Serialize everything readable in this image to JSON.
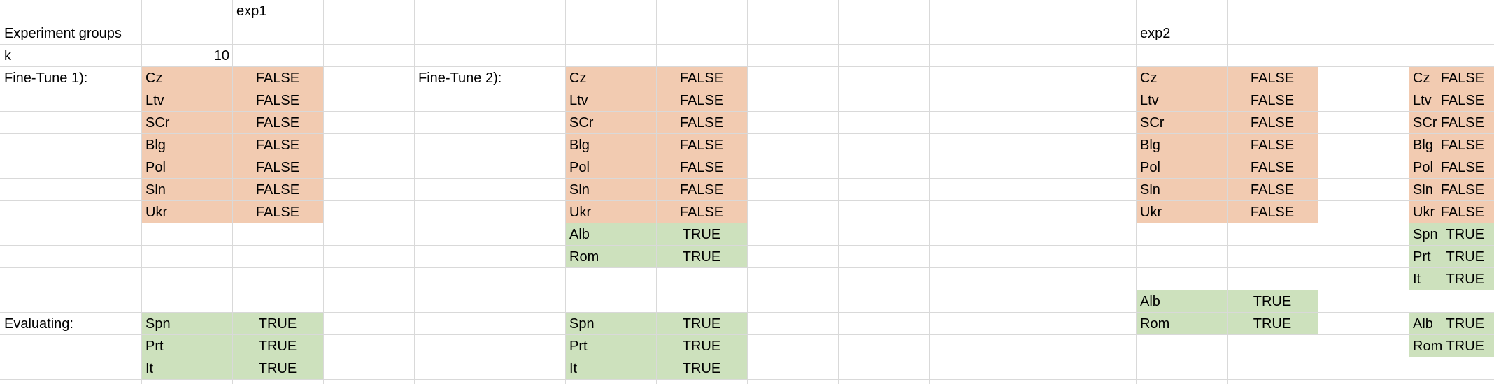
{
  "sheet": {
    "title": "exp1",
    "experiment_groups_label": "Experiment groups",
    "k_label": "k",
    "k_value": "10",
    "exp2_label": "exp2",
    "finetune1_label": "Fine-Tune 1):",
    "finetune2_label": "Fine-Tune 2):",
    "evaluating_label": "Evaluating:",
    "colors": {
      "salmon": "#f2cbb1",
      "green": "#cde1bd",
      "gridline": "#d9d9d9"
    },
    "block_a": [
      {
        "lang": "Cz",
        "val": "FALSE"
      },
      {
        "lang": "Ltv",
        "val": "FALSE"
      },
      {
        "lang": "SCr",
        "val": "FALSE"
      },
      {
        "lang": "Blg",
        "val": "FALSE"
      },
      {
        "lang": "Pol",
        "val": "FALSE"
      },
      {
        "lang": "Sln",
        "val": "FALSE"
      },
      {
        "lang": "Ukr",
        "val": "FALSE"
      }
    ],
    "block_a_eval": [
      {
        "lang": "Spn",
        "val": "TRUE"
      },
      {
        "lang": "Prt",
        "val": "TRUE"
      },
      {
        "lang": "It",
        "val": "TRUE"
      }
    ],
    "block_b": [
      {
        "lang": "Cz",
        "val": "FALSE"
      },
      {
        "lang": "Ltv",
        "val": "FALSE"
      },
      {
        "lang": "SCr",
        "val": "FALSE"
      },
      {
        "lang": "Blg",
        "val": "FALSE"
      },
      {
        "lang": "Pol",
        "val": "FALSE"
      },
      {
        "lang": "Sln",
        "val": "FALSE"
      },
      {
        "lang": "Ukr",
        "val": "FALSE"
      }
    ],
    "block_b_extra": [
      {
        "lang": "Alb",
        "val": "TRUE"
      },
      {
        "lang": "Rom",
        "val": "TRUE"
      }
    ],
    "block_b_eval": [
      {
        "lang": "Spn",
        "val": "TRUE"
      },
      {
        "lang": "Prt",
        "val": "TRUE"
      },
      {
        "lang": "It",
        "val": "TRUE"
      }
    ],
    "block_c": [
      {
        "lang": "Cz",
        "val": "FALSE"
      },
      {
        "lang": "Ltv",
        "val": "FALSE"
      },
      {
        "lang": "SCr",
        "val": "FALSE"
      },
      {
        "lang": "Blg",
        "val": "FALSE"
      },
      {
        "lang": "Pol",
        "val": "FALSE"
      },
      {
        "lang": "Sln",
        "val": "FALSE"
      },
      {
        "lang": "Ukr",
        "val": "FALSE"
      }
    ],
    "block_c_eval": [
      {
        "lang": "Alb",
        "val": "TRUE"
      },
      {
        "lang": "Rom",
        "val": "TRUE"
      }
    ],
    "block_d": [
      {
        "lang": "Cz",
        "val": "FALSE"
      },
      {
        "lang": "Ltv",
        "val": "FALSE"
      },
      {
        "lang": "SCr",
        "val": "FALSE"
      },
      {
        "lang": "Blg",
        "val": "FALSE"
      },
      {
        "lang": "Pol",
        "val": "FALSE"
      },
      {
        "lang": "Sln",
        "val": "FALSE"
      },
      {
        "lang": "Ukr",
        "val": "FALSE"
      }
    ],
    "block_d_extra": [
      {
        "lang": "Spn",
        "val": "TRUE"
      },
      {
        "lang": "Prt",
        "val": "TRUE"
      },
      {
        "lang": "It",
        "val": "TRUE"
      }
    ],
    "block_d_eval": [
      {
        "lang": "Alb",
        "val": "TRUE"
      },
      {
        "lang": "Rom",
        "val": "TRUE"
      }
    ]
  }
}
